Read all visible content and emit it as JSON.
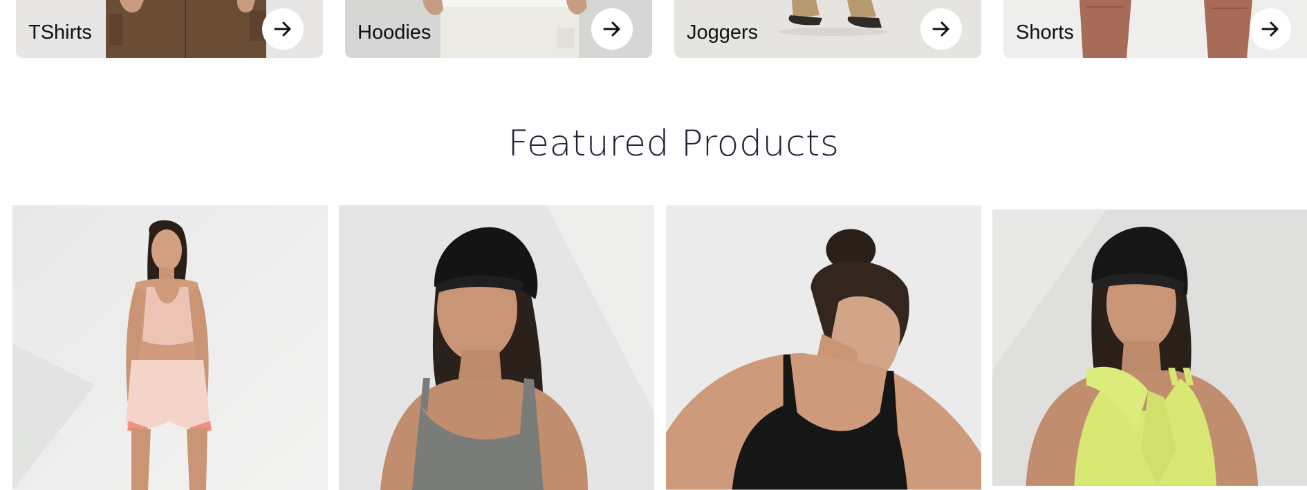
{
  "categories": [
    {
      "label": "TShirts",
      "arrow_icon": "arrow-right-icon"
    },
    {
      "label": "Hoodies",
      "arrow_icon": "arrow-right-icon"
    },
    {
      "label": "Joggers",
      "arrow_icon": "arrow-right-icon"
    },
    {
      "label": "Shorts",
      "arrow_icon": "arrow-right-icon"
    }
  ],
  "featured": {
    "title": "Featured Products",
    "products": [
      {
        "image": "woman in pink sports bra and shorts"
      },
      {
        "image": "woman in black cap and grey tank top"
      },
      {
        "image": "woman in black sports bra"
      },
      {
        "image": "woman in black cap and lime green top"
      }
    ]
  },
  "colors": {
    "heading": "#1e2235",
    "card_bg_light": "#e9e9e8",
    "card_bg_mid": "#dcdcda",
    "photo_bg": "#ecedec"
  }
}
